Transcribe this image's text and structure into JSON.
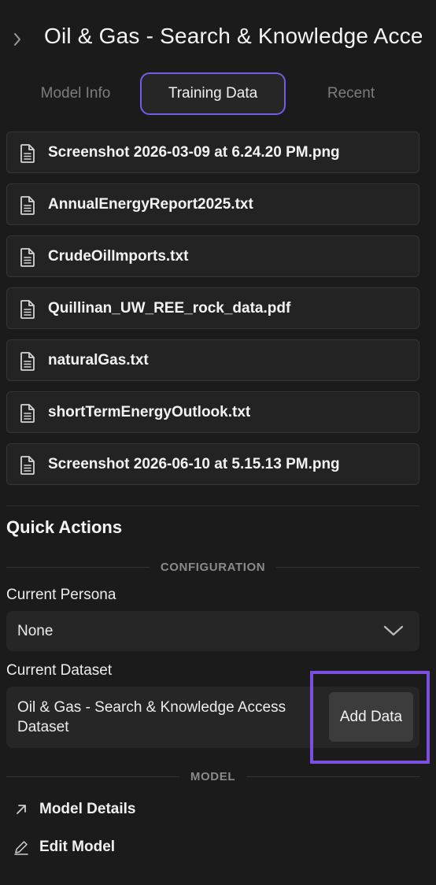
{
  "header": {
    "title": "Oil & Gas - Search & Knowledge Access",
    "back_icon": "chevron-right-icon"
  },
  "tabs": [
    {
      "label": "Model Info",
      "active": false
    },
    {
      "label": "Training Data",
      "active": true
    },
    {
      "label": "Recent",
      "active": false
    }
  ],
  "files": [
    {
      "name": "Screenshot 2026-03-09 at 6.24.20 PM.png",
      "icon": "file-text-icon"
    },
    {
      "name": "AnnualEnergyReport2025.txt",
      "icon": "file-text-icon"
    },
    {
      "name": "CrudeOilImports.txt",
      "icon": "file-text-icon"
    },
    {
      "name": "Quillinan_UW_REE_rock_data.pdf",
      "icon": "file-text-icon"
    },
    {
      "name": "naturalGas.txt",
      "icon": "file-text-icon"
    },
    {
      "name": "shortTermEnergyOutlook.txt",
      "icon": "file-text-icon"
    },
    {
      "name": "Screenshot 2026-06-10 at 5.15.13 PM.png",
      "icon": "file-text-icon"
    }
  ],
  "quick_actions": {
    "title": "Quick Actions",
    "configuration_label": "CONFIGURATION",
    "persona_label": "Current Persona",
    "persona_value": "None",
    "dataset_label": "Current Dataset",
    "dataset_value": "Oil & Gas - Search & Knowledge Access Dataset",
    "add_data_label": "Add Data",
    "model_label": "MODEL",
    "model_details_label": "Model Details",
    "edit_model_label": "Edit Model"
  },
  "colors": {
    "background": "#1b1b1b",
    "accent": "#6f5ee6",
    "highlight": "#7b4fe0"
  }
}
